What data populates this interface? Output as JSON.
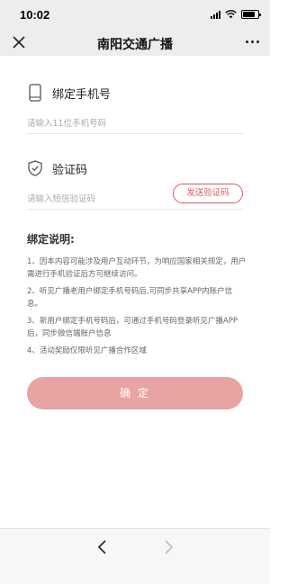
{
  "status": {
    "time": "10:02"
  },
  "nav": {
    "title": "南阳交通广播",
    "close_icon": "close-icon",
    "more_icon": "more-icon"
  },
  "phone": {
    "label": "绑定手机号",
    "placeholder": "请输入11位手机号码",
    "icon": "phone-icon"
  },
  "code": {
    "label": "验证码",
    "placeholder": "请输入短信验证码",
    "send_button": "发送验证码",
    "icon": "shield-check-icon"
  },
  "notes": {
    "title": "绑定说明:",
    "items": [
      "1、因本内容可能涉及用户互动环节，为响应国家相关规定，用户需进行手机验证后方可继续访问。",
      "2、听见广播老用户绑定手机号码后,可同步共享APP内账户信息。",
      "3、新用户绑定手机号码后，可通过手机号码登录听见广播APP后，同步微信端账户信息",
      "4、活动奖励仅限听见广播合作区域"
    ]
  },
  "confirm": {
    "label": "确 定"
  },
  "colors": {
    "accent": "#d45b5b",
    "confirm_bg": "#e8a3a3",
    "bar_bg": "#ededed"
  }
}
